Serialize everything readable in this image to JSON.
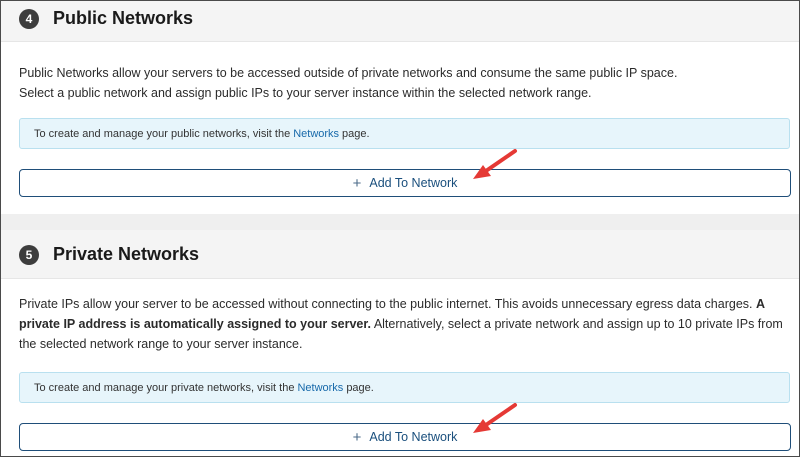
{
  "public_networks": {
    "step": "4",
    "title": "Public Networks",
    "description_line1": "Public Networks allow your servers to be accessed outside of private networks and consume the same public IP space.",
    "description_line2": "Select a public network and assign public IPs to your server instance within the selected network range.",
    "info_prefix": "To create and manage your public networks, visit the",
    "info_link": "Networks",
    "info_suffix": "page.",
    "button_label": "Add To Network"
  },
  "private_networks": {
    "step": "5",
    "title": "Private Networks",
    "description_part1": "Private IPs allow your server to be accessed without connecting to the public internet. This avoids unnecessary egress data charges.",
    "description_bold": "A private IP address is automatically assigned to your server.",
    "description_part2": "Alternatively, select a private network and assign up to 10 private IPs from the selected network range to your server instance.",
    "info_prefix": "To create and manage your private networks, visit the",
    "info_link": "Networks",
    "info_suffix": "page.",
    "button_label": "Add To Network"
  },
  "icons": {
    "add": "plus-icon",
    "annotation": "red-arrow-icon"
  },
  "colors": {
    "badge": "#3d3d3d",
    "link": "#1769aa",
    "info_bg": "#e7f5fb",
    "button_border": "#1f4e79",
    "arrow": "#e53935"
  }
}
